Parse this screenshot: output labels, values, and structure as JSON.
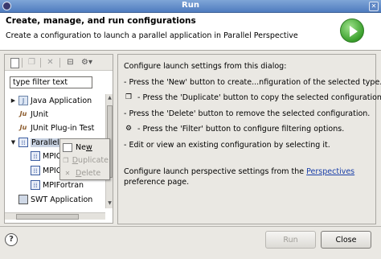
{
  "window": {
    "title": "Run"
  },
  "banner": {
    "title": "Create, manage, and run configurations",
    "subtitle": "Create a configuration to launch a parallel application in Parallel Perspective"
  },
  "filter": {
    "value": "type filter text"
  },
  "tree": {
    "items": [
      {
        "label": "Java Application",
        "icon": "java-app-icon"
      },
      {
        "label": "JUnit",
        "icon": "junit-icon"
      },
      {
        "label": "JUnit Plug-in Test",
        "icon": "junit-plugin-icon"
      },
      {
        "label": "Parallel",
        "icon": "parallel-icon"
      },
      {
        "label": "MPIC",
        "icon": "parallel-config-icon"
      },
      {
        "label": "MPIC",
        "icon": "parallel-config-icon"
      },
      {
        "label": "MPIFortran",
        "icon": "parallel-config-icon"
      },
      {
        "label": "SWT Application",
        "icon": "swt-icon"
      }
    ]
  },
  "context_menu": {
    "new_prefix": "Ne",
    "new_u": "w",
    "dup_prefix": "",
    "dup_u": "D",
    "dup_rest": "uplicate",
    "del_prefix": "",
    "del_u": "D",
    "del_rest": "elete"
  },
  "help_panel": {
    "intro": "Configure launch settings from this dialog:",
    "line_new": "- Press the 'New' button to create...nfiguration of the selected type.",
    "line_dup": "- Press the 'Duplicate' button to copy the selected configuration.",
    "line_del": "- Press the 'Delete' button to remove the selected configuration.",
    "line_filter": "- Press the 'Filter' button to configure filtering options.",
    "line_edit": "- Edit or view an existing configuration by selecting it.",
    "persp_prefix": "Configure launch perspective settings from the ",
    "persp_link": "Perspectives",
    "persp_suffix": "preference page."
  },
  "buttons": {
    "help": "?",
    "run": "Run",
    "close": "Close"
  },
  "colors": {
    "title_bar": "#4f7cbf",
    "link": "#1a3fa8",
    "selection": "#c7d1e0"
  }
}
